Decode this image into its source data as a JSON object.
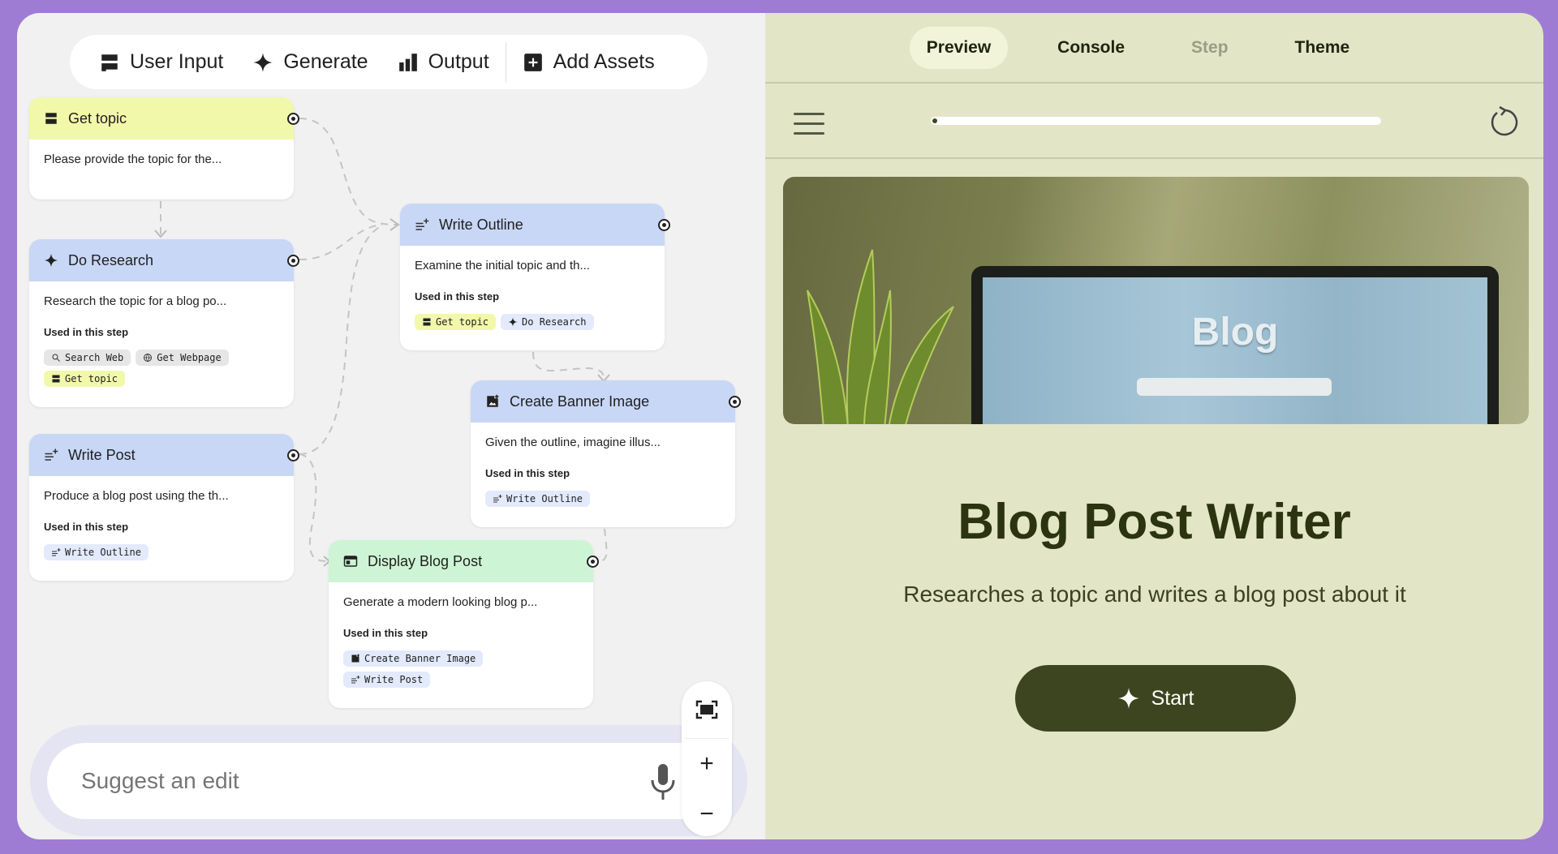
{
  "toolbar": {
    "items": [
      {
        "label": "User Input",
        "icon": "user-input-icon"
      },
      {
        "label": "Generate",
        "icon": "sparkle-icon"
      },
      {
        "label": "Output",
        "icon": "output-icon"
      },
      {
        "label": "Add Assets",
        "icon": "add-box-icon"
      }
    ]
  },
  "nodes": {
    "get_topic": {
      "title": "Get topic",
      "desc": "Please provide the topic for the..."
    },
    "do_research": {
      "title": "Do Research",
      "desc": "Research the topic for a blog po...",
      "used": "Used in this step",
      "chips": [
        "Search Web",
        "Get Webpage",
        "Get topic"
      ]
    },
    "write_post": {
      "title": "Write Post",
      "desc": "Produce a blog post using the th...",
      "used": "Used in this step",
      "chips": [
        "Write Outline"
      ]
    },
    "write_outline": {
      "title": "Write Outline",
      "desc": "Examine the initial topic and th...",
      "used": "Used in this step",
      "chips": [
        "Get topic",
        "Do Research"
      ]
    },
    "create_banner": {
      "title": "Create Banner Image",
      "desc": "Given the outline, imagine illus...",
      "used": "Used in this step",
      "chips": [
        "Write Outline"
      ]
    },
    "display_blog": {
      "title": "Display Blog Post",
      "desc": "Generate a modern looking blog p...",
      "used": "Used in this step",
      "chips": [
        "Create Banner Image",
        "Write Post"
      ]
    }
  },
  "suggest": {
    "placeholder": "Suggest an edit"
  },
  "zoom": {
    "plus": "+",
    "minus": "−"
  },
  "tabs": [
    "Preview",
    "Console",
    "Step",
    "Theme"
  ],
  "active_tab": "Preview",
  "progress": 0.0,
  "preview": {
    "image_text": "Blog",
    "title": "Blog Post Writer",
    "subtitle": "Researches a topic and writes a blog post about it",
    "start_label": "Start"
  },
  "colors": {
    "frame": "#9e7cd3",
    "input_node": "#f1f8a9",
    "generate_node": "#c8d7f6",
    "output_node": "#cdf5d5",
    "start_button": "#3d4520",
    "preview_bg": "#e3e5c7"
  }
}
